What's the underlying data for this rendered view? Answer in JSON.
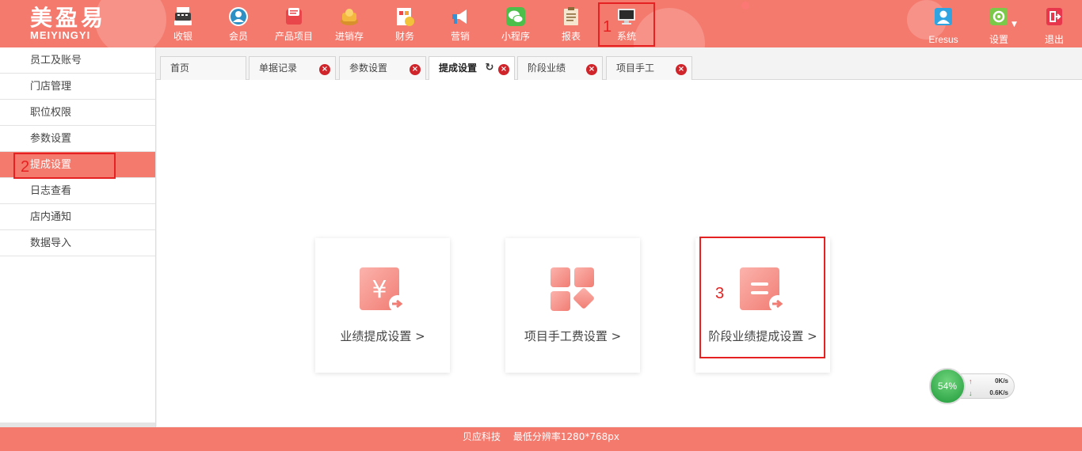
{
  "logo": {
    "cn": "美盈易",
    "en": "MEIYINGYI"
  },
  "nav": [
    {
      "label": "收银",
      "icon": "cash-register-icon"
    },
    {
      "label": "会员",
      "icon": "member-icon"
    },
    {
      "label": "产品项目",
      "icon": "product-icon"
    },
    {
      "label": "进销存",
      "icon": "inventory-icon"
    },
    {
      "label": "财务",
      "icon": "finance-icon"
    },
    {
      "label": "营销",
      "icon": "megaphone-icon"
    },
    {
      "label": "小程序",
      "icon": "wechat-icon"
    },
    {
      "label": "报表",
      "icon": "report-icon"
    },
    {
      "label": "系统",
      "icon": "monitor-icon"
    }
  ],
  "user": {
    "name": "Eresus",
    "settings": "设置",
    "logout": "退出"
  },
  "sidebar": [
    {
      "label": "员工及账号"
    },
    {
      "label": "门店管理"
    },
    {
      "label": "职位权限"
    },
    {
      "label": "参数设置"
    },
    {
      "label": "提成设置"
    },
    {
      "label": "日志查看"
    },
    {
      "label": "店内通知"
    },
    {
      "label": "数据导入"
    }
  ],
  "tabs": [
    {
      "label": "首页"
    },
    {
      "label": "单据记录"
    },
    {
      "label": "参数设置"
    },
    {
      "label": "提成设置"
    },
    {
      "label": "阶段业绩"
    },
    {
      "label": "项目手工"
    }
  ],
  "cards": [
    {
      "label": "业绩提成设置 >",
      "icon": "yuan-share-icon"
    },
    {
      "label": "项目手工费设置 >",
      "icon": "grid-diamond-icon"
    },
    {
      "label": "阶段业绩提成设置 >",
      "icon": "list-share-icon"
    }
  ],
  "annotations": {
    "n1": "1",
    "n2": "2",
    "n3": "3"
  },
  "footer": {
    "company": "贝应科技",
    "resolution": "最低分辨率1280*768px"
  },
  "network": {
    "percent": "54%",
    "up": "0K/s",
    "down": "0.6K/s"
  },
  "colors": {
    "brand": "#f47a6e",
    "highlight": "#e52121",
    "tab_close": "#d0242b"
  }
}
